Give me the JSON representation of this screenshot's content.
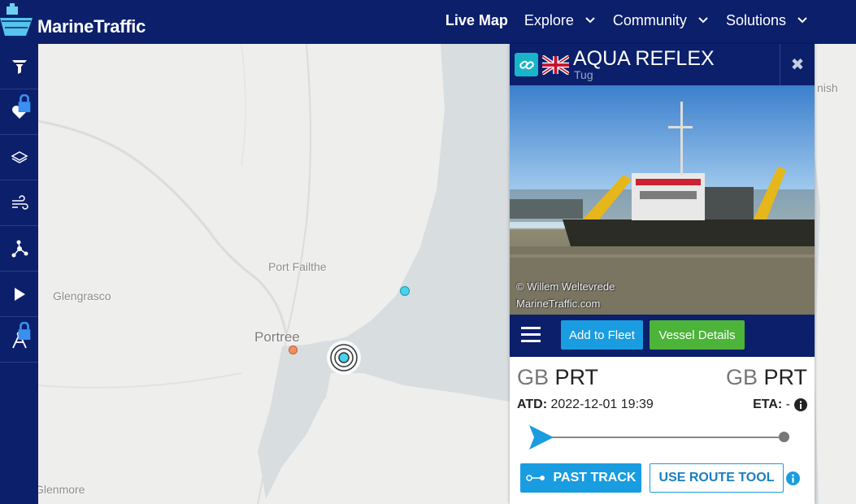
{
  "brand": {
    "name": "MarineTraffic"
  },
  "nav": [
    {
      "label": "Live Map",
      "active": true,
      "dropdown": false
    },
    {
      "label": "Explore",
      "active": false,
      "dropdown": true
    },
    {
      "label": "Community",
      "active": false,
      "dropdown": true
    },
    {
      "label": "Solutions",
      "active": false,
      "dropdown": true
    }
  ],
  "sidebar": [
    {
      "icon": "filter-icon",
      "locked": false
    },
    {
      "icon": "heart-icon",
      "locked": true
    },
    {
      "icon": "layers-icon",
      "locked": false
    },
    {
      "icon": "wind-icon",
      "locked": false
    },
    {
      "icon": "network-icon",
      "locked": false
    },
    {
      "icon": "play-icon",
      "locked": false
    },
    {
      "icon": "compass-measure-icon",
      "locked": true
    }
  ],
  "map": {
    "places": [
      "Port Failthe",
      "Glengrasco",
      "Portree",
      "Glenmore",
      "nish"
    ]
  },
  "vessel": {
    "name": "AQUA REFLEX",
    "type": "Tug",
    "flag": "united-kingdom-flag",
    "photo_credit_1": "© Willem Weltevrede",
    "photo_credit_2": "MarineTraffic.com",
    "add_to_fleet": "Add to Fleet",
    "vessel_details": "Vessel Details",
    "departure": {
      "country": "GB",
      "port": "PRT"
    },
    "arrival": {
      "country": "GB",
      "port": "PRT"
    },
    "atd_label": "ATD:",
    "atd_value": "2022-12-01 19:39",
    "eta_label": "ETA:",
    "eta_value": "-",
    "voyage_progress": 0.0,
    "past_track": "PAST TRACK",
    "route_tool": "USE ROUTE TOOL"
  },
  "colors": {
    "navy": "#0b1f6b",
    "blue_button": "#1a9ce0",
    "green_button": "#4db43a",
    "teal": "#19b4c8"
  }
}
